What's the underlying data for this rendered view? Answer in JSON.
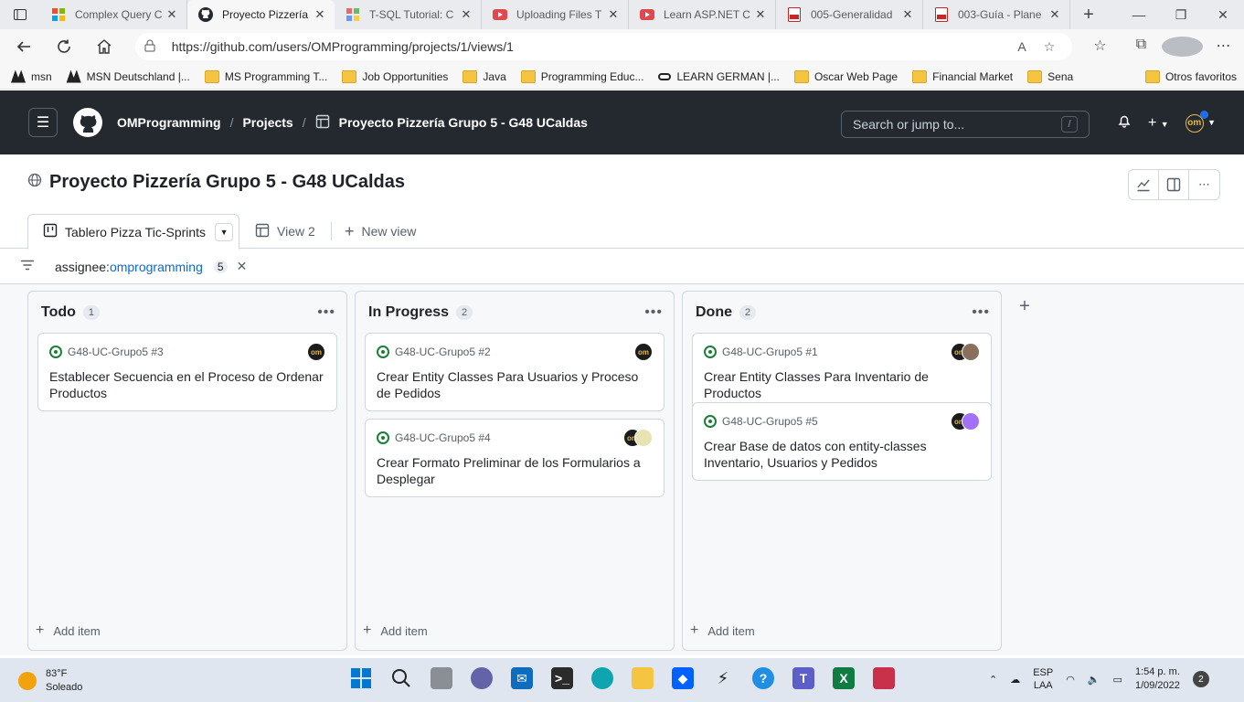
{
  "browser": {
    "tabs": [
      {
        "label": "Complex Query C",
        "favicon": "colored-squares",
        "color": "#9a9a9a"
      },
      {
        "label": "Proyecto Pizzería",
        "favicon": "github",
        "color": "#24292f",
        "active": true
      },
      {
        "label": "T-SQL Tutorial: C",
        "favicon": "colored-squares",
        "color": "#9a9a9a"
      },
      {
        "label": "Uploading Files T",
        "favicon": "youtube",
        "color": "#e0484e"
      },
      {
        "label": "Learn ASP.NET C",
        "favicon": "youtube",
        "color": "#e0484e"
      },
      {
        "label": "005-Generalidad",
        "favicon": "pdf",
        "color": "#c62828"
      },
      {
        "label": "003-Guía - Plane",
        "favicon": "pdf",
        "color": "#c62828"
      }
    ],
    "url": "https://github.com/users/OMProgramming/projects/1/views/1",
    "favorites": [
      {
        "label": "msn",
        "type": "msn"
      },
      {
        "label": "MSN Deutschland |...",
        "type": "msn"
      },
      {
        "label": "MS Programming T...",
        "type": "folder"
      },
      {
        "label": "Job Opportunities",
        "type": "folder"
      },
      {
        "label": "Java",
        "type": "folder"
      },
      {
        "label": "Programming Educ...",
        "type": "folder"
      },
      {
        "label": "LEARN GERMAN |...",
        "type": "link"
      },
      {
        "label": "Oscar Web Page",
        "type": "folder"
      },
      {
        "label": "Financial Market",
        "type": "folder"
      },
      {
        "label": "Sena",
        "type": "folder"
      }
    ],
    "other_favorites": "Otros favoritos"
  },
  "github": {
    "owner": "OMProgramming",
    "projects": "Projects",
    "project_crumb": "Proyecto Pizzería Grupo 5 - G48 UCaldas",
    "search_placeholder": "Search or jump to...",
    "search_key": "/",
    "avatar_text": "om"
  },
  "project": {
    "title": "Proyecto Pizzería Grupo 5 - G48 UCaldas",
    "views": [
      {
        "label": "Tablero Pizza Tic-Sprints",
        "active": true
      },
      {
        "label": "View 2"
      }
    ],
    "new_view": "New view",
    "filter": {
      "key": "assignee:",
      "value": "omprogramming",
      "count": "5"
    }
  },
  "board": {
    "columns": [
      {
        "name": "Todo",
        "count": "1",
        "cards": [
          {
            "ref": "G48-UC-Grupo5 #3",
            "title": "Establecer Secuencia en el Proceso de Ordenar Productos"
          }
        ]
      },
      {
        "name": "In Progress",
        "count": "2",
        "cards": [
          {
            "ref": "G48-UC-Grupo5 #2",
            "title": "Crear Entity Classes Para Usuarios y Proceso de Pedidos"
          },
          {
            "ref": "G48-UC-Grupo5 #4",
            "title": "Crear Formato Preliminar de los Formularios a Desplegar"
          }
        ]
      },
      {
        "name": "Done",
        "count": "2",
        "cards": [
          {
            "ref": "G48-UC-Grupo5 #1",
            "title": "Crear Entity Classes Para Inventario de Productos"
          },
          {
            "ref": "G48-UC-Grupo5 #5",
            "title": "Crear Base de datos con entity-classes Inventario, Usuarios y Pedidos"
          }
        ]
      }
    ],
    "add_item": "Add item"
  },
  "taskbar": {
    "temperature": "83°F",
    "condition": "Soleado",
    "lang_top": "ESP",
    "lang_bottom": "LAA",
    "time": "1:54 p. m.",
    "date": "1/09/2022",
    "notifications": "2"
  }
}
